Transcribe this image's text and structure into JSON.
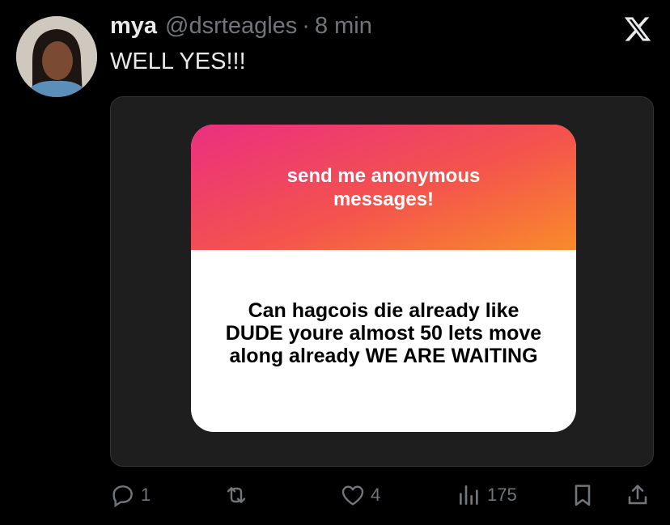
{
  "tweet": {
    "author_name": "mya",
    "author_handle": "@dsrteagles",
    "separator": "·",
    "time": "8 min",
    "text": "WELL YES!!!"
  },
  "card": {
    "prompt": "send me anonymous messages!",
    "message": "Can hagcois die already like DUDE youre almost 50 lets move along already WE ARE WAITING",
    "gradient_colors": [
      "#ea2f80",
      "#f4534d",
      "#f98b2a"
    ]
  },
  "actions": {
    "replies": "1",
    "likes": "4",
    "views": "175"
  },
  "icons": [
    "x-logo-icon",
    "reply-icon",
    "retweet-icon",
    "heart-icon",
    "views-icon",
    "bookmark-icon",
    "share-icon"
  ]
}
